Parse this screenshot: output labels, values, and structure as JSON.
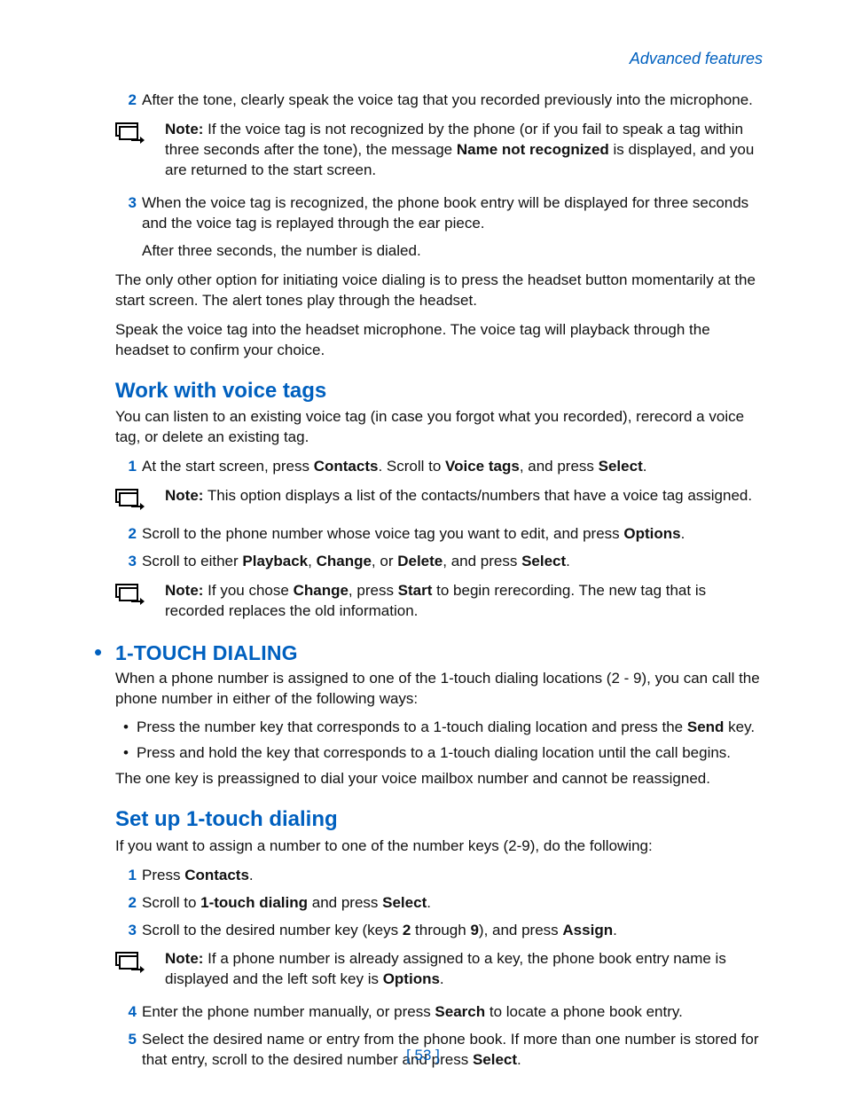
{
  "header": "Advanced features",
  "step2a": {
    "num": "2",
    "text": "After the tone, clearly speak the voice tag that you recorded previously into the microphone."
  },
  "note1": {
    "label": "Note:",
    "t1": " If the voice tag is not recognized by the phone (or if you fail to speak a tag within three seconds after the tone), the message ",
    "b1": "Name not recognized",
    "t2": " is displayed, and you are returned to the start screen."
  },
  "step3a": {
    "num": "3",
    "text": "When the voice tag is recognized, the phone book entry will be displayed for three seconds and the voice tag is replayed through the ear piece."
  },
  "after3": "After three seconds, the number is dialed.",
  "para1": "The only other option for initiating voice dialing is to press the headset button momentarily at the start screen. The alert tones play through the headset.",
  "para2": "Speak the voice tag into the headset microphone. The voice tag will playback through the headset to confirm your choice.",
  "h_work": "Work with voice tags",
  "work_intro": "You can listen to an existing voice tag (in case you forgot what you recorded), rerecord a voice tag, or delete an existing tag.",
  "w1": {
    "num": "1",
    "t1": "At the start screen, press ",
    "b1": "Contacts",
    "t2": ". Scroll to ",
    "b2": "Voice tags",
    "t3": ", and press ",
    "b3": "Select",
    "t4": "."
  },
  "note2": {
    "label": "Note:",
    "text": " This option displays a list of the contacts/numbers that have a voice tag assigned."
  },
  "w2": {
    "num": "2",
    "t1": "Scroll to the phone number whose voice tag you want to edit, and press ",
    "b1": "Options",
    "t2": "."
  },
  "w3": {
    "num": "3",
    "t1": "Scroll to either ",
    "b1": "Playback",
    "t2": ", ",
    "b2": "Change",
    "t3": ", or ",
    "b3": "Delete",
    "t4": ", and press ",
    "b4": "Select",
    "t5": "."
  },
  "note3": {
    "label": "Note:",
    "t1": " If you chose ",
    "b1": "Change",
    "t2": ", press ",
    "b2": "Start",
    "t3": " to begin rerecording. The new tag that is recorded replaces the old information."
  },
  "h_touch": "1-TOUCH DIALING",
  "touch_intro": "When a phone number is assigned to one of the 1-touch dialing locations (2 - 9), you can call the phone number in either of the following ways:",
  "tb1": {
    "t1": "Press the number key that corresponds to a 1-touch dialing location and press the ",
    "b1": "Send",
    "t2": " key."
  },
  "tb2": "Press and hold the key that corresponds to a 1-touch dialing location until the call begins.",
  "touch_after": "The one key is preassigned to dial your voice mailbox number and cannot be reassigned.",
  "h_setup": "Set up 1-touch dialing",
  "setup_intro": "If you want to assign a number to one of the number keys (2-9), do the following:",
  "s1": {
    "num": "1",
    "t1": "Press ",
    "b1": "Contacts",
    "t2": "."
  },
  "s2": {
    "num": "2",
    "t1": "Scroll to ",
    "b1": "1-touch dialing",
    "t2": " and press ",
    "b2": "Select",
    "t3": "."
  },
  "s3": {
    "num": "3",
    "t1": "Scroll to the desired number key (keys ",
    "b1": "2",
    "t2": " through ",
    "b2": "9",
    "t3": "), and press ",
    "b3": "Assign",
    "t4": "."
  },
  "note4": {
    "label": "Note:",
    "t1": " If a phone number is already assigned to a key, the phone book entry name is displayed and the left soft key is ",
    "b1": "Options",
    "t2": "."
  },
  "s4": {
    "num": "4",
    "t1": "Enter the phone number manually, or press ",
    "b1": "Search",
    "t2": " to locate a phone book entry."
  },
  "s5": {
    "num": "5",
    "t1": "Select the desired name or entry from the phone book. If more than one number is stored for that entry, scroll to the desired number and press ",
    "b1": "Select",
    "t2": "."
  },
  "page_num": "[ 53 ]"
}
